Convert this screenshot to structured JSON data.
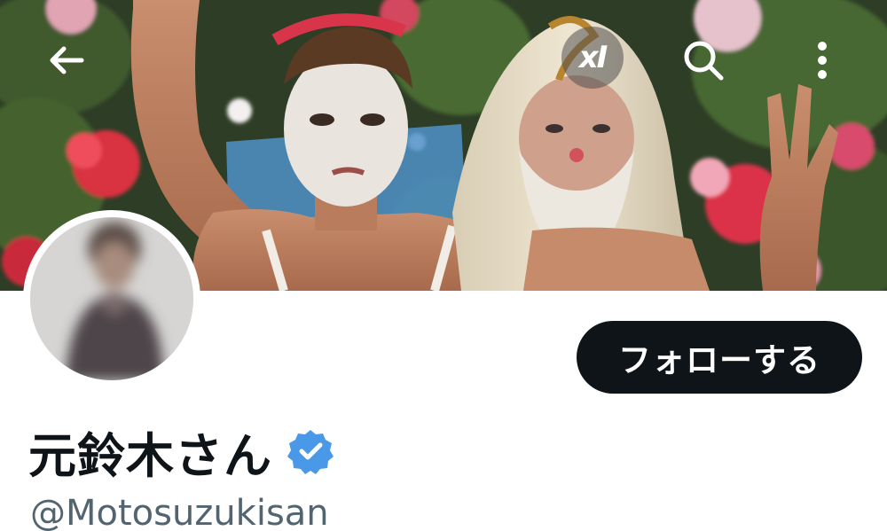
{
  "header": {
    "back_icon": "arrow-left-icon",
    "grok_icon": "xai-grok-icon",
    "grok_label": "xI",
    "search_icon": "search-icon",
    "more_icon": "more-vertical-icon"
  },
  "profile": {
    "display_name": "元鈴木さん",
    "handle": "@Motosuzukisan",
    "verified": true,
    "verified_color": "#4a99e9",
    "follow_label": "フォローする"
  },
  "colors": {
    "text_primary": "#0f1419",
    "text_secondary": "#536471",
    "button_bg": "#0f1419"
  }
}
